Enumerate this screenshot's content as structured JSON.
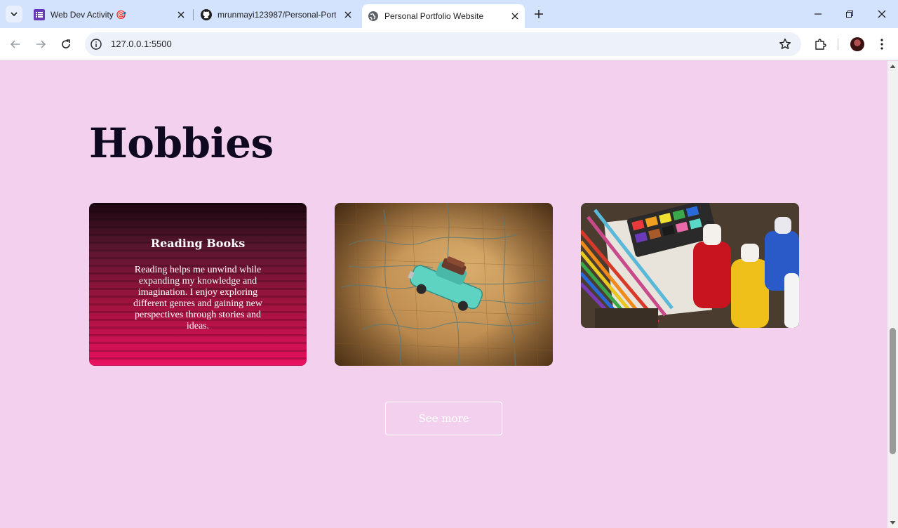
{
  "browser": {
    "tabs": [
      {
        "title": "Web Dev Activity 🎯",
        "favicon": "forms-icon",
        "active": false
      },
      {
        "title": "mrunmayi123987/Personal-Port",
        "favicon": "github-icon",
        "active": false
      },
      {
        "title": "Personal Portfolio Website",
        "favicon": "globe-icon",
        "active": true
      }
    ],
    "url": "127.0.0.1:5500",
    "colors": {
      "tabstrip": "#d3e3fd",
      "toolbar": "#ffffff",
      "omnibox": "#edf2fa"
    }
  },
  "page": {
    "heading": "Hobbies",
    "cards": [
      {
        "title": "Reading Books",
        "description": "Reading helps me unwind while expanding my knowledge and imagination. I enjoy exploring different genres and gaining new perspectives through stories and ideas.",
        "image": "stacked books photo with pink overlay"
      },
      {
        "image": "toy car on vintage map photo"
      },
      {
        "image": "art supplies, colored pencils and paint bottles photo"
      }
    ],
    "see_more_label": "See more",
    "colors": {
      "background": "#f3d1ee",
      "heading": "#0e0820",
      "card_overlay": "#e0105a"
    }
  }
}
